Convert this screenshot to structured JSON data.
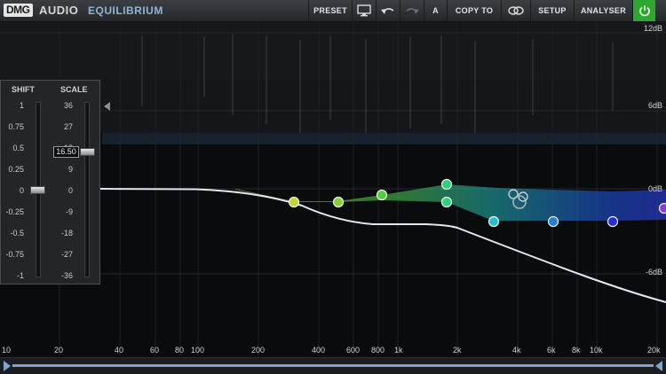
{
  "app": {
    "logo_brand": "DMG",
    "logo_audio": "AUDIO",
    "product": "EQUILIBRIUM"
  },
  "toolbar": {
    "preset": "PRESET",
    "ab": "A",
    "copy_to": "COPY TO",
    "setup": "SETUP",
    "analyser": "ANALYSER"
  },
  "left_panel": {
    "shift_label": "SHIFT",
    "scale_label": "SCALE",
    "shift_ticks": [
      "1",
      "0.75",
      "0.5",
      "0.25",
      "0",
      "-0.25",
      "-0.5",
      "-0.75",
      "-1"
    ],
    "scale_ticks": [
      "36",
      "27",
      "18",
      "9",
      "0",
      "-9",
      "-18",
      "-27",
      "-36"
    ],
    "shift_value": 0,
    "scale_value": "16.50"
  },
  "db_labels": [
    "12dB",
    "6dB",
    "0dB",
    "-6dB"
  ],
  "freq_labels": [
    "10",
    "20",
    "40",
    "60",
    "80",
    "100",
    "200",
    "400",
    "600",
    "800",
    "1k",
    "2k",
    "4k",
    "6k",
    "8k",
    "10k",
    "20k"
  ],
  "colors": {
    "accent": "#8fb5d6",
    "power": "#2fa82f",
    "curve": "#e6e6f0"
  }
}
